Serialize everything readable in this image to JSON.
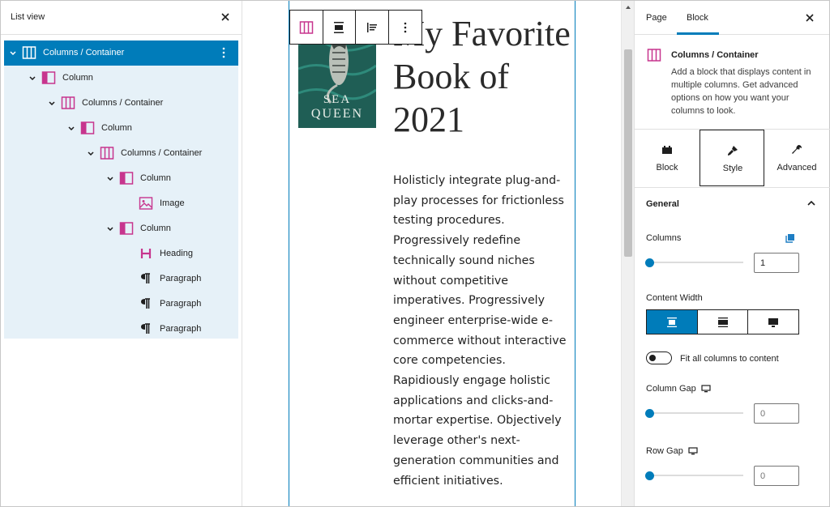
{
  "listview": {
    "title": "List view",
    "rows": [
      {
        "label": "Columns / Container",
        "icon": "columns-icon",
        "selected": true
      },
      {
        "label": "Column",
        "icon": "column-icon"
      },
      {
        "label": "Columns / Container",
        "icon": "columns-icon"
      },
      {
        "label": "Column",
        "icon": "column-icon"
      },
      {
        "label": "Columns / Container",
        "icon": "columns-icon"
      },
      {
        "label": "Column",
        "icon": "column-icon"
      },
      {
        "label": "Image",
        "icon": "image-icon"
      },
      {
        "label": "Column",
        "icon": "column-icon"
      },
      {
        "label": "Heading",
        "icon": "heading-icon"
      },
      {
        "label": "Paragraph",
        "icon": "paragraph-icon"
      },
      {
        "label": "Paragraph",
        "icon": "paragraph-icon"
      },
      {
        "label": "Paragraph",
        "icon": "paragraph-icon"
      }
    ]
  },
  "canvas": {
    "book_cover": {
      "line1": "SEA",
      "line2": "QUEEN"
    },
    "heading": "My Favorite Book of 2021",
    "paragraph": "Holisticly integrate plug-and-play processes for frictionless testing procedures. Progressively redefine technically sound niches without competitive imperatives. Progressively engineer enterprise-wide e-commerce without interactive core competencies. Rapidiously engage holistic applications and clicks-and-mortar expertise. Objectively leverage other's next-generation communities and efficient initiatives."
  },
  "inspector": {
    "tabs": {
      "page": "Page",
      "block": "Block"
    },
    "block_card": {
      "title": "Columns / Container",
      "description": "Add a block that displays content in multiple columns. Get advanced options on how you want your columns to look."
    },
    "subtabs": {
      "block": "Block",
      "style": "Style",
      "advanced": "Advanced"
    },
    "general": {
      "title": "General",
      "columns_label": "Columns",
      "columns_value": "1",
      "content_width_label": "Content Width",
      "fit_label": "Fit all columns to content",
      "column_gap_label": "Column Gap",
      "column_gap_value": "0",
      "row_gap_label": "Row Gap",
      "row_gap_value": "0"
    }
  },
  "colors": {
    "accent": "#007cba",
    "tree_bg": "#e6f1f8",
    "icon_pink": "#c7358e"
  }
}
